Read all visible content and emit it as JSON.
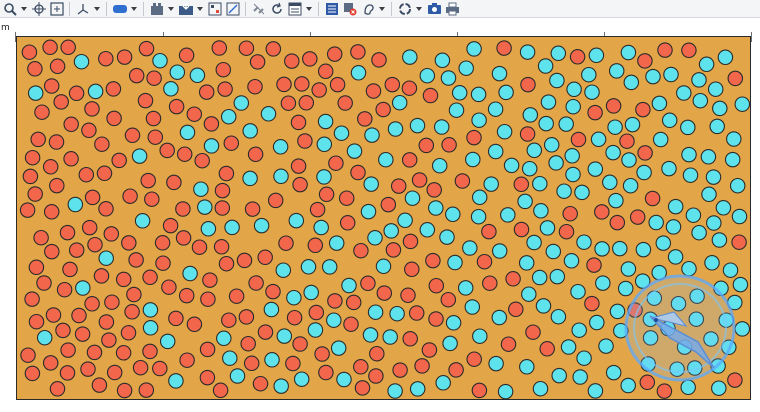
{
  "ruler": {
    "unit": "m"
  },
  "toolbar": {
    "buttons": [
      {
        "name": "zoom-icon",
        "dropdown": true
      },
      {
        "name": "pan-crosshair-icon",
        "dropdown": false
      },
      {
        "name": "fit-view-icon",
        "dropdown": false
      },
      {
        "name": "axes-icon",
        "dropdown": true
      },
      {
        "name": "render-mode-icon",
        "dropdown": true
      },
      {
        "name": "scene-settings-icon",
        "dropdown": true
      },
      {
        "name": "export-scene-icon",
        "dropdown": true
      },
      {
        "name": "snap-grid-icon",
        "dropdown": false
      },
      {
        "name": "measure-icon",
        "dropdown": false
      },
      {
        "name": "hide-links-icon",
        "dropdown": false
      },
      {
        "name": "reset-rotation-icon",
        "dropdown": false
      },
      {
        "name": "layout-window-icon",
        "dropdown": true
      },
      {
        "name": "statistics-icon",
        "dropdown": false
      },
      {
        "name": "clear-history-icon",
        "dropdown": false
      },
      {
        "name": "sound-icon",
        "dropdown": true
      },
      {
        "name": "recycle-icon",
        "dropdown": true
      },
      {
        "name": "camera-icon",
        "dropdown": false
      },
      {
        "name": "print-icon",
        "dropdown": false
      }
    ]
  },
  "simulation": {
    "colors": {
      "background": "#e2a548",
      "red": "#f2664b",
      "cyan": "#5ee3ec",
      "stroke": "#2b2b2b"
    },
    "particle_count": 560,
    "red_fraction_left": 0.95,
    "red_fraction_right": 0.05
  },
  "overlay": {
    "icon": "rotate-bird-icon"
  }
}
